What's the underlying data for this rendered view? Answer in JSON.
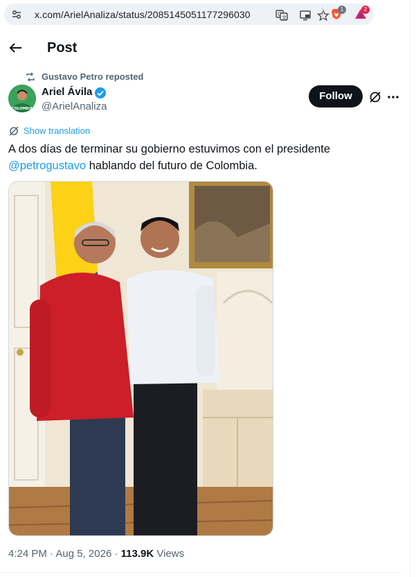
{
  "browser": {
    "url": "x.com/ArielAnaliza/status/2085145051177296030",
    "extensions": [
      {
        "icon": "brave-lion-icon",
        "badge": "1",
        "color": "#fb542b"
      },
      {
        "icon": "brave-rewards-triangle-icon",
        "badge": "2",
        "color": "#e0264e"
      }
    ]
  },
  "header": {
    "title": "Post"
  },
  "repost": {
    "text": "Gustavo Petro reposted"
  },
  "author": {
    "name": "Ariel Ávila",
    "handle": "@ArielAnaliza",
    "avatar_caption": "COLOMBIA",
    "verified_color": "#1d9bf0"
  },
  "actions": {
    "follow_label": "Follow"
  },
  "tweet": {
    "translate_label": "Show translation",
    "text_before": "A dos días de terminar su gobierno estuvimos con el presidente",
    "mention": "@petrogustavo",
    "text_after": " hablando del futuro de Colombia."
  },
  "footer": {
    "time": "4:24 PM",
    "separator": " · ",
    "date": "Aug 5, 2026",
    "views_count": "113.9K",
    "views_label": " Views"
  }
}
